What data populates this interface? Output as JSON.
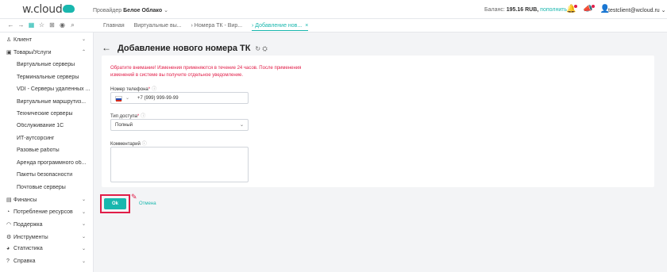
{
  "header": {
    "logo_text": "w.cloud",
    "provider_prefix": "Провайдер",
    "provider_name": "Белое Облако",
    "provider_chevron": "⌄",
    "balance_label": "Баланс:",
    "balance_value": "195.16 RUB,",
    "balance_link": "пополнить",
    "user_email": "testclient@wcloud.ru",
    "user_chevron": "⌄"
  },
  "toolbar": {
    "icons": [
      "back-arrow-icon",
      "forward-arrow-icon",
      "grid-icon",
      "star-icon",
      "cart-icon",
      "eye-icon",
      "search-icon"
    ]
  },
  "tabs": [
    {
      "label": "Главная"
    },
    {
      "label": "Виртуальные вы..."
    },
    {
      "label": "› Номера ТК - Вир..."
    },
    {
      "label": "› Добавление нов...",
      "close": "×"
    }
  ],
  "sidebar": {
    "sections": [
      {
        "label": "Клиент",
        "icon": "user-icon",
        "chevron": "⌄"
      },
      {
        "label": "Товары/Услуги",
        "icon": "box-icon",
        "chevron": "⌃"
      }
    ],
    "sub_items": [
      "Виртуальные серверы",
      "Терминальные серверы",
      "VDI - Серверы удаленных ...",
      "Виртуальные маршрутиз...",
      "Технические серверы",
      "Обслуживание 1С",
      "ИТ-аутсорсинг",
      "Разовые работы",
      "Аренда программного об...",
      "Пакеты безопасности",
      "Почтовые серверы"
    ],
    "bottom": [
      {
        "label": "Финансы",
        "icon": "doc-icon",
        "chevron": "⌄"
      },
      {
        "label": "Потребление ресурсов",
        "icon": "chart-pie-icon",
        "chevron": "⌄"
      },
      {
        "label": "Поддержка",
        "icon": "headset-icon",
        "chevron": "⌄"
      },
      {
        "label": "Инструменты",
        "icon": "gear-icon",
        "chevron": "⌄"
      },
      {
        "label": "Статистика",
        "icon": "stats-icon",
        "chevron": "⌄"
      },
      {
        "label": "Справка",
        "icon": "help-icon",
        "chevron": "⌄"
      }
    ]
  },
  "page": {
    "back": "←",
    "title": "Добавление нового номера ТК",
    "title_icons": "↻ ⛭"
  },
  "form": {
    "warning_line1": "Обратите внимание! Изменения применяются в течение 24 часов. После применения",
    "warning_line2": "изменений в системе вы получите отдельное уведомление.",
    "phone_label": "Номер телефона",
    "phone_value": "+7 (999) 999-99-99",
    "access_label": "Тип доступа",
    "access_value": "Полный",
    "comment_label": "Комментарий",
    "comment_value": "",
    "required_mark": "*",
    "hint_mark": "ⓘ",
    "dropdown_chevron": "⌄"
  },
  "actions": {
    "ok": "Ok",
    "cancel": "Отмена"
  },
  "colors": {
    "accent": "#19b7ae",
    "warning": "#e11d48"
  }
}
